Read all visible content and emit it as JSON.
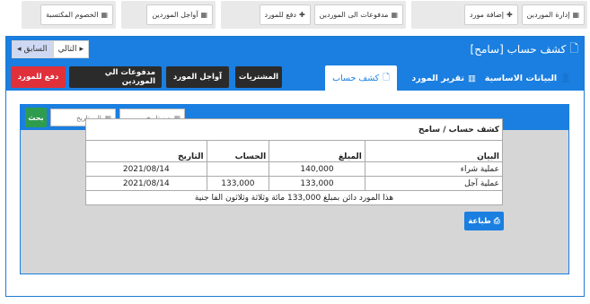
{
  "toolbar": {
    "group1": {
      "manage_suppliers": "إدارة الموردين",
      "add_supplier": "إضافة مورد"
    },
    "group2": {
      "supplier_payments": "مدفوعات الى الموردين",
      "pay_supplier": "دفع للمورد"
    },
    "group3": {
      "supplier_deadlines": "آواجل الموردين"
    },
    "group4": {
      "earned_discounts": "الخصوم المكتسبة"
    }
  },
  "panel": {
    "title": "كشف حساب [سامح]",
    "next_label": "التالي",
    "prev_label": "السابق"
  },
  "tabs": {
    "basic_data": "البيانات الاساسية",
    "supplier_report": "تقرير المورد",
    "account_statement": "كشف حساب"
  },
  "actions": {
    "purchases": "المشتريات",
    "supplier_deadlines": "آواجل المورد",
    "supplier_payments": "مدفوعات الي الموردين",
    "pay_supplier": "دفع للمورد"
  },
  "filter": {
    "from_placeholder": "من تاريخ",
    "to_placeholder": "الى تاريخ",
    "search_label": "بحث"
  },
  "report": {
    "title": "كشف حساب / سامح",
    "columns": {
      "statement": "البيان",
      "amount": "المبلغ",
      "account": "الحساب",
      "date": "التاريخ"
    },
    "rows": [
      {
        "statement": "عملية شراء",
        "amount": "140,000",
        "account": "",
        "date": "2021/08/14"
      },
      {
        "statement": "عملية آجل",
        "amount": "133,000",
        "account": "133,000",
        "date": "2021/08/14"
      }
    ],
    "summary": "هذا المورد دائن بمبلغ 133,000 مائة وثلاثة وثلاثون الفا جنية"
  },
  "print_label": "طباعة",
  "colors": {
    "primary": "#1a7fe0",
    "danger": "#e0303a",
    "success": "#2e9c4e",
    "dark": "#2b2b2b"
  }
}
